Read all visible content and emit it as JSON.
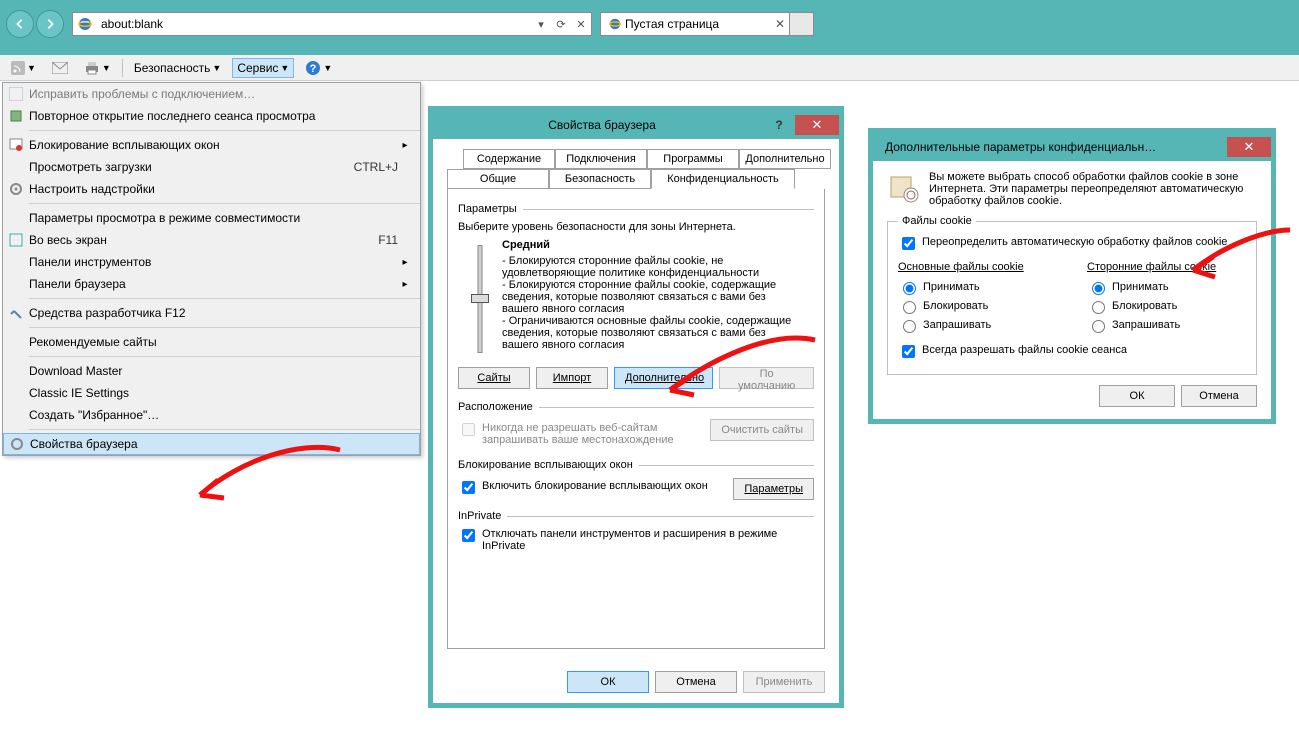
{
  "address": {
    "url": "about:blank"
  },
  "tab": {
    "title": "Пустая страница"
  },
  "toolbar": {
    "security": "Безопасность",
    "tools": "Сервис"
  },
  "menu": {
    "fix": "Исправить проблемы с подключением…",
    "reopen": "Повторное открытие последнего сеанса просмотра",
    "popup": "Блокирование всплывающих окон",
    "downloads": "Просмотреть загрузки",
    "downloads_sc": "CTRL+J",
    "addons": "Настроить надстройки",
    "compat": "Параметры просмотра в режиме совместимости",
    "fullscreen": "Во весь экран",
    "fullscreen_sc": "F11",
    "toolbars": "Панели инструментов",
    "panels": "Панели браузера",
    "f12": "Средства разработчика F12",
    "recommended": "Рекомендуемые сайты",
    "dm": "Download Master",
    "classic": "Classic IE Settings",
    "fav": "Создать \"Избранное\"…",
    "props": "Свойства браузера"
  },
  "dlg1": {
    "title": "Свойства браузера",
    "tabs": {
      "content": "Содержание",
      "connections": "Подключения",
      "programs": "Программы",
      "advanced": "Дополнительно",
      "general": "Общие",
      "security": "Безопасность",
      "privacy": "Конфиденциальность"
    },
    "group_params": "Параметры",
    "select_level": "Выберите уровень безопасности для зоны Интернета.",
    "level": "Средний",
    "bullets": {
      "b1": "- Блокируются сторонние файлы cookie, не удовлетворяющие политике конфиденциальности",
      "b2": "- Блокируются сторонние файлы cookie, содержащие сведения, которые позволяют связаться с вами без вашего явного согласия",
      "b3": "- Ограничиваются основные файлы cookie, содержащие сведения, которые позволяют связаться с вами без вашего явного согласия"
    },
    "btn_sites": "Сайты",
    "btn_import": "Импорт",
    "btn_more": "Дополнительно",
    "btn_default": "По умолчанию",
    "group_location": "Расположение",
    "loc_never": "Никогда не разрешать веб-сайтам запрашивать ваше местонахождение",
    "btn_clearsites": "Очистить сайты",
    "group_popup": "Блокирование всплывающих окон",
    "popup_enable": "Включить блокирование всплывающих окон",
    "btn_popup_params": "Параметры",
    "group_inprivate": "InPrivate",
    "inprivate_off": "Отключать панели инструментов и расширения в режиме InPrivate",
    "ok": "ОК",
    "cancel": "Отмена",
    "apply": "Применить"
  },
  "dlg2": {
    "title": "Дополнительные параметры конфиденциальн…",
    "intro": "Вы можете выбрать способ обработки файлов cookie в зоне Интернета. Эти параметры переопределяют автоматическую обработку файлов cookie.",
    "legend": "Файлы cookie",
    "override": "Переопределить автоматическую обработку файлов cookie",
    "col_main": "Основные файлы cookie",
    "col_third": "Сторонние файлы cookie",
    "accept": "Принимать",
    "block": "Блокировать",
    "ask": "Запрашивать",
    "session": "Всегда разрешать файлы cookie сеанса",
    "ok": "ОК",
    "cancel": "Отмена"
  }
}
